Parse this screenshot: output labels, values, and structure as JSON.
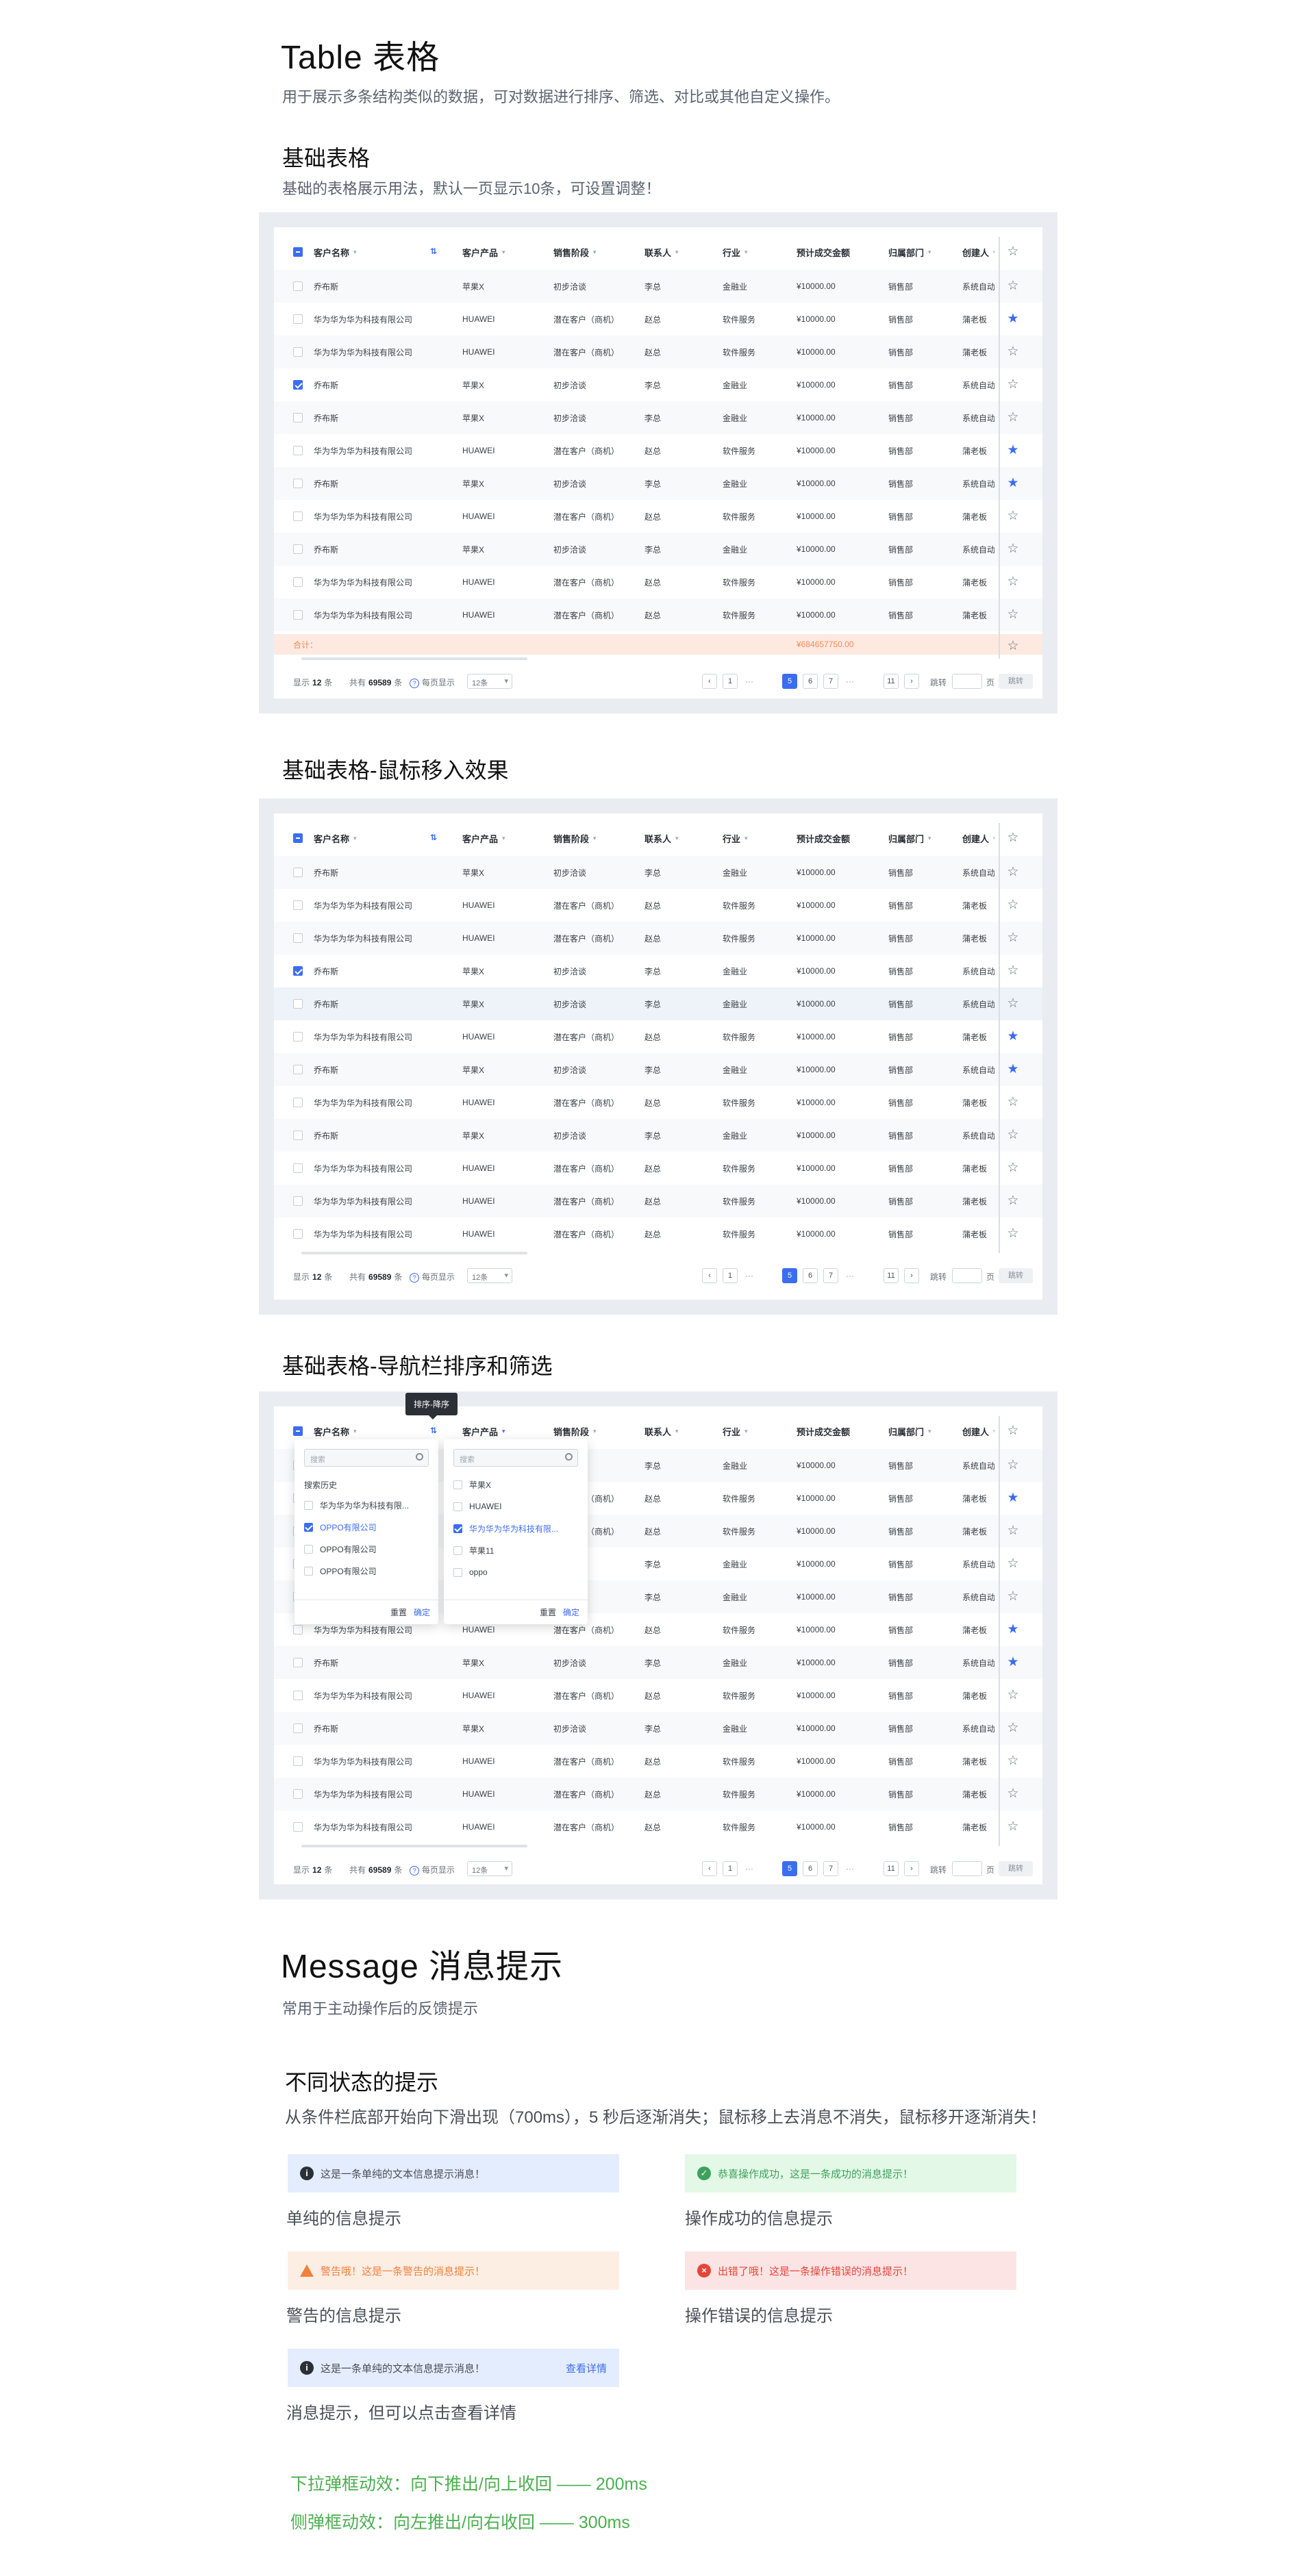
{
  "table_section": {
    "title": "Table 表格",
    "desc": "用于展示多条结构类似的数据，可对数据进行排序、筛选、对比或其他自定义操作。",
    "basic_title": "基础表格",
    "basic_desc": "基础的表格展示用法，默认一页显示10条，可设置调整！",
    "hover_title": "基础表格-鼠标移入效果",
    "filter_title": "基础表格-导航栏排序和筛选"
  },
  "columns": [
    "客户名称",
    "客户产品",
    "销售阶段",
    "联系人",
    "行业",
    "预计成交金额",
    "归属部门",
    "创建人"
  ],
  "rows_a": {
    "name": "乔布斯",
    "product": "苹果X",
    "stage": "初步洽谈",
    "contact": "李总",
    "industry": "金融业",
    "amount": "¥10000.00",
    "dept": "销售部",
    "creator": "系统自动"
  },
  "rows_b": {
    "name": "华为华为华为科技有限公司",
    "product": "HUAWEI",
    "stage": "潜在客户（商机）",
    "contact": "赵总",
    "industry": "软件服务",
    "amount": "¥10000.00",
    "dept": "销售部",
    "creator": "蒲老板"
  },
  "summary": {
    "label": "合计：",
    "amount": "¥684657750.00"
  },
  "footer": {
    "show_prefix": "显示",
    "show_count": "12",
    "show_suffix": "条",
    "total_prefix": "共有",
    "total_count": "69589",
    "total_suffix": "条",
    "per_page_label": "每页显示",
    "per_page_value": "12条",
    "pages": [
      "1",
      "5",
      "6",
      "7",
      "11"
    ],
    "ellipsis": "···",
    "jump_label": "跳转",
    "page_unit": "页",
    "go_label": "跳转"
  },
  "tooltip": "排序-降序",
  "dropdown_left": {
    "placeholder": "搜索",
    "history_label": "搜索历史",
    "items": [
      "华为华为华为科技有限...",
      "OPPO有限公司",
      "OPPO有限公司",
      "OPPO有限公司"
    ],
    "reset": "重置",
    "confirm": "确定"
  },
  "dropdown_right": {
    "placeholder": "搜索",
    "items": [
      "苹果X",
      "HUAWEI",
      "华为华为华为科技有限...",
      "苹果11",
      "oppo"
    ],
    "reset": "重置",
    "confirm": "确定"
  },
  "message_section": {
    "title": "Message 消息提示",
    "desc": "常用于主动操作后的反馈提示",
    "states_title": "不同状态的提示",
    "states_desc": "从条件栏底部开始向下滑出现（700ms），5 秒后逐渐消失；鼠标移上去消息不消失，鼠标移开逐渐消失！"
  },
  "messages": {
    "info_text": "这是一条单纯的文本信息提示消息！",
    "info_caption": "单纯的信息提示",
    "ok_text": "恭喜操作成功，这是一条成功的消息提示！",
    "ok_caption": "操作成功的信息提示",
    "warn_text": "警告哦！这是一条警告的消息提示！",
    "warn_caption": "警告的信息提示",
    "err_text": "出错了哦！这是一条操作错误的消息提示！",
    "err_caption": "操作错误的信息提示",
    "link_text": "这是一条单纯的文本信息提示消息！",
    "link_action": "查看详情",
    "link_caption": "消息提示，但可以点击查看详情"
  },
  "animation": {
    "dropdown": "下拉弹框动效：向下推出/向上收回 —— 200ms",
    "side": "侧弹框动效：向左推出/向右收回 —— 300ms"
  },
  "colors": {
    "primary": "#3c6cf0",
    "success": "#3ea25c",
    "warning": "#f0803c",
    "error": "#e6453a",
    "panel_bg": "#e9edf2"
  }
}
